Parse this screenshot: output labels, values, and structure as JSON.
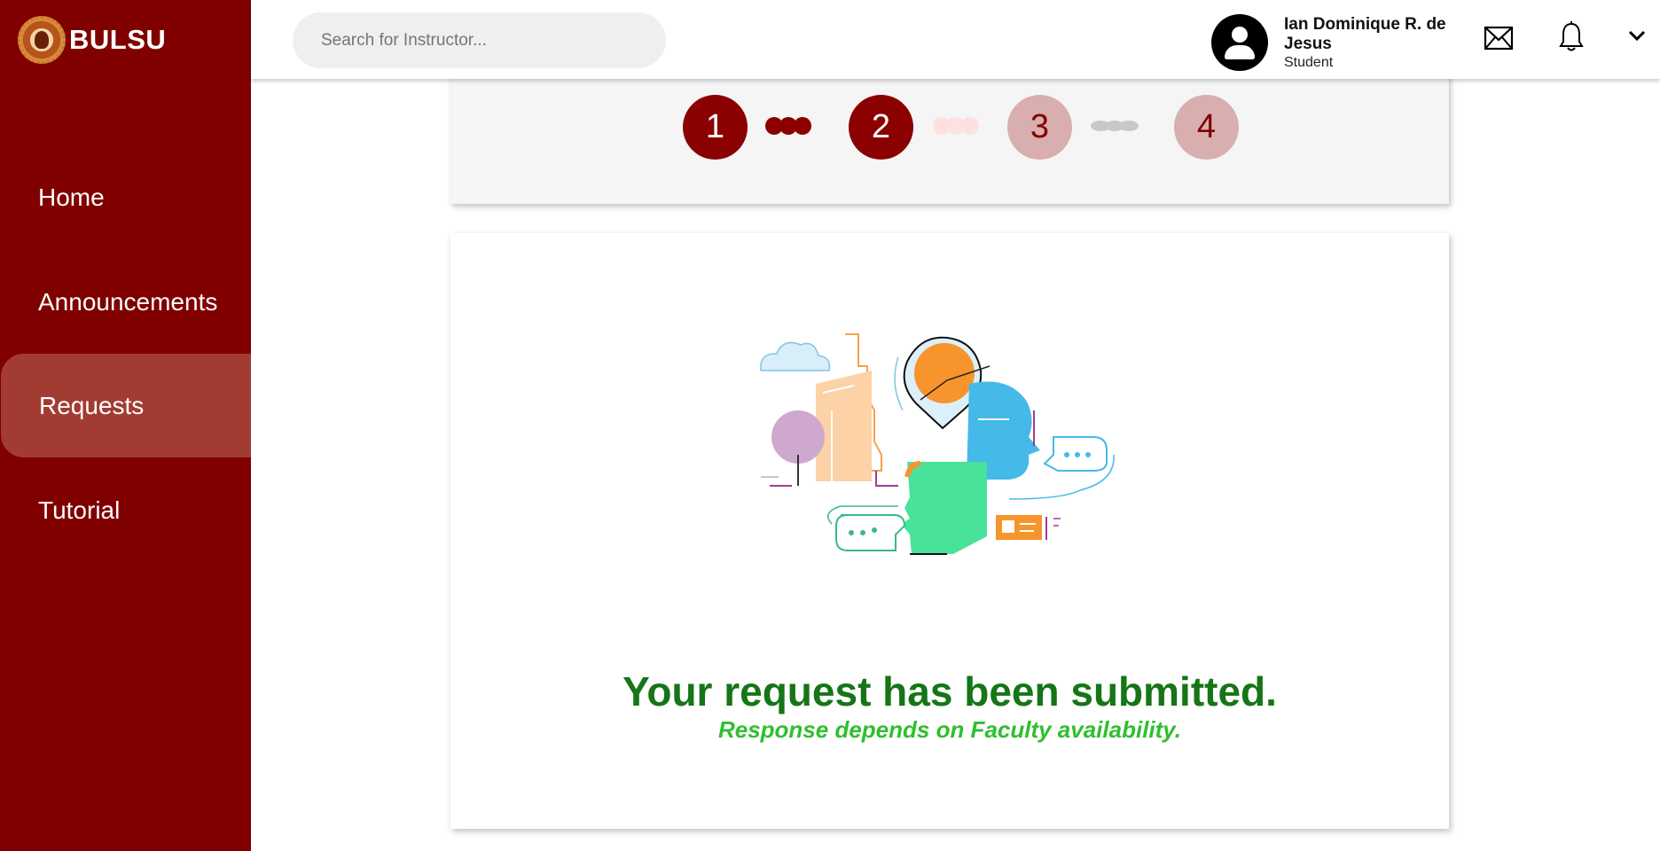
{
  "brand": {
    "name": "BULSU",
    "logo_icon": "bulsu-seal-icon"
  },
  "sidebar": {
    "items": [
      {
        "label": "Home",
        "active": false
      },
      {
        "label": "Announcements",
        "active": false
      },
      {
        "label": "Requests",
        "active": true
      },
      {
        "label": "Tutorial",
        "active": false
      }
    ]
  },
  "header": {
    "search_placeholder": "Search for Instructor...",
    "user": {
      "name": "Ian Dominique R. de Jesus",
      "role": "Student"
    },
    "icons": [
      "mail-icon",
      "bell-icon",
      "chevron-down-icon"
    ]
  },
  "stepper": {
    "steps": [
      {
        "number": "1",
        "state": "done"
      },
      {
        "number": "2",
        "state": "done"
      },
      {
        "number": "3",
        "state": "pending"
      },
      {
        "number": "4",
        "state": "pending"
      }
    ]
  },
  "confirmation": {
    "title": "Your request has been submitted.",
    "subtitle": "Response depends on Faculty availability."
  },
  "colors": {
    "sidebar": "#800000",
    "sidebar_active": "#a23c33",
    "step_done": "#8b0000",
    "step_pending": "#d9aeae",
    "title": "#167516",
    "subtitle": "#2fbf2f"
  }
}
